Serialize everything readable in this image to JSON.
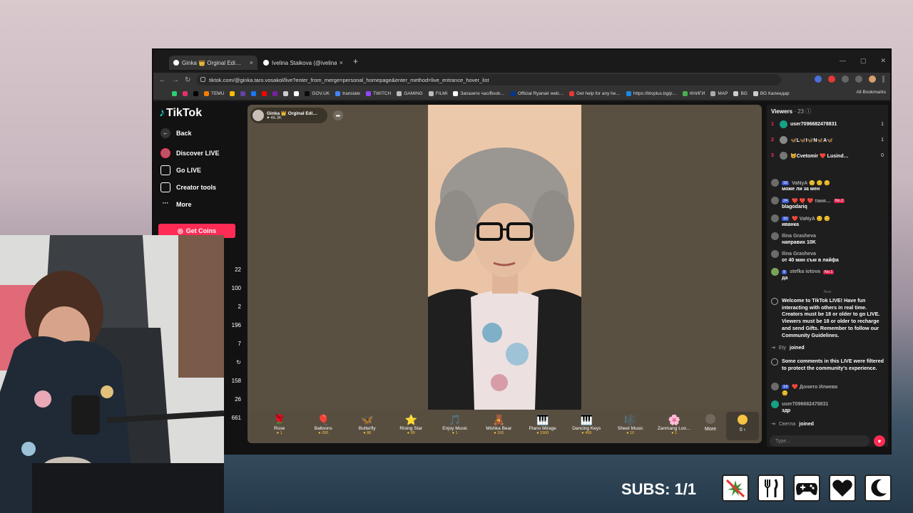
{
  "browser": {
    "tabs": [
      {
        "title": "Ginka 👑 Orginal Edi…",
        "active": true
      },
      {
        "title": "Ivelina Staikova (@ivelinastaik…",
        "active": false
      }
    ],
    "url": "tiktok.com/@ginka.taro.vosakol/live?enter_from_merge=personal_homepage&enter_method=live_entrance_hover_list",
    "bookmarks": [
      {
        "label": "",
        "color": "#2ecc71"
      },
      {
        "label": "",
        "color": "#e1306c"
      },
      {
        "label": "",
        "color": "#000000"
      },
      {
        "label": "TEMU",
        "color": "#f57c00"
      },
      {
        "label": "",
        "color": "#fbbc05"
      },
      {
        "label": "",
        "color": "#6441a5"
      },
      {
        "label": "",
        "color": "#1877f2"
      },
      {
        "label": "",
        "color": "#ff0000"
      },
      {
        "label": "",
        "color": "#7b1fa2"
      },
      {
        "label": "",
        "color": "#cccccc"
      },
      {
        "label": "",
        "color": "#ffffff"
      },
      {
        "label": "GOV.UK",
        "color": "#0b0c0c"
      },
      {
        "label": "translate",
        "color": "#4285f4"
      },
      {
        "label": "TWITCH",
        "color": "#9146ff"
      },
      {
        "label": "GAMING",
        "color": "#bbbbbb"
      },
      {
        "label": "FILMI",
        "color": "#bbbbbb"
      },
      {
        "label": "Запазете час/Book…",
        "color": "#ffffff"
      },
      {
        "label": "Official Ryanair web…",
        "color": "#073590"
      },
      {
        "label": "Get help for any he…",
        "color": "#e53935"
      },
      {
        "label": "https://btvplus.bg/p…",
        "color": "#1e88e5"
      },
      {
        "label": "КНИГИ",
        "color": "#4caf50"
      },
      {
        "label": "MAP",
        "color": "#aaaaaa"
      },
      {
        "label": "BG",
        "color": "#cccccc"
      },
      {
        "label": "BG Календар",
        "color": "#cccccc"
      }
    ],
    "all_bookmarks": "All Bookmarks"
  },
  "sidebar": {
    "logo": "TikTok",
    "items": [
      {
        "label": "Back",
        "icon": "back-arrow-icon"
      },
      {
        "label": "Discover LIVE",
        "icon": "live-avatar-icon"
      },
      {
        "label": "Go LIVE",
        "icon": "camera-icon"
      },
      {
        "label": "Creator tools",
        "icon": "creator-tools-icon"
      },
      {
        "label": "More",
        "icon": "more-dots-icon"
      }
    ],
    "get_coins": "Get Coins",
    "ranks": [
      "22",
      "100",
      "2",
      "196",
      "7",
      "158",
      "26",
      "661"
    ]
  },
  "stream": {
    "host_name": "Ginka 👑 Orginal Edi…",
    "host_likes": "♥ 46.3K",
    "gifts": [
      {
        "name": "Rose",
        "cost": "1",
        "icon": "🌹"
      },
      {
        "name": "Balloons",
        "cost": "200",
        "icon": "🎈"
      },
      {
        "name": "Butterfly",
        "cost": "88",
        "icon": "🦋"
      },
      {
        "name": "Rising Star",
        "cost": "99",
        "icon": "⭐"
      },
      {
        "name": "Enjoy Music",
        "cost": "1",
        "icon": "🎵"
      },
      {
        "name": "Mishka Bear",
        "cost": "100",
        "icon": "🧸"
      },
      {
        "name": "Piano Mirage",
        "cost": "1500",
        "icon": "🎹"
      },
      {
        "name": "Dancing Keys",
        "cost": "499",
        "icon": "🎹"
      },
      {
        "name": "Sheet Music",
        "cost": "10",
        "icon": "🎼"
      },
      {
        "name": "Zanmang Loo…",
        "cost": "1",
        "icon": "🌸"
      }
    ],
    "more_label": "More",
    "coins": "0 ›"
  },
  "chat": {
    "viewers_label": "Viewers",
    "viewers_count": "· 23",
    "top_viewers": [
      {
        "rank": "1",
        "name": "user7096682478831",
        "score": "1"
      },
      {
        "rank": "2",
        "name": "🦋L🦋I🦋N🦋A🦋",
        "score": "1"
      },
      {
        "rank": "3",
        "name": "😺Cvetomir ❤️ Lusind…",
        "score": "0"
      }
    ],
    "messages": [
      {
        "badge": "16",
        "user": "VaNyA 😊 😊 😊",
        "text": "може ли за мен",
        "nob": ""
      },
      {
        "badge": "24",
        "user": "❤️ ❤️ ❤️ таня…",
        "text": "blagodariq",
        "nob": "No.2"
      },
      {
        "badge": "16",
        "user": "❤️ VaNyA 😊 😊",
        "text": "иванка",
        "nob": ""
      },
      {
        "badge": "",
        "user": "Ilina Grasheva",
        "text": "направих 10K",
        "nob": ""
      },
      {
        "badge": "",
        "user": "Ilina Grasheva",
        "text": "от 40 мин съм в лайфа",
        "nob": ""
      },
      {
        "badge": "9",
        "user": "stefka iotova",
        "text": "да",
        "nob": "No.1"
      }
    ],
    "now_label": "Now",
    "welcome": "Welcome to TikTok LIVE! Have fun interacting with others in real time. Creators must be 18 or older to go LIVE. Viewers must be 18 or older to recharge and send Gifts. Remember to follow our Community Guidelines.",
    "joined1_user": "Ety",
    "joined_word": "joined",
    "filtered": "Some comments in this LIVE were filtered to protect the community's experience.",
    "msg7_badge": "14",
    "msg7_user": "❤️ Донито Илиева",
    "msg7_text": "😊",
    "msg8_user": "user7096682478831",
    "msg8_text": "здр",
    "joined2_user": "Светла",
    "input_placeholder": "Type..."
  },
  "overlay": {
    "subs": "SUBS: 1/1",
    "icons": [
      "no-weed-icon",
      "fork-knife-icon",
      "gamepad-icon",
      "heart-icon",
      "moon-icon"
    ]
  }
}
